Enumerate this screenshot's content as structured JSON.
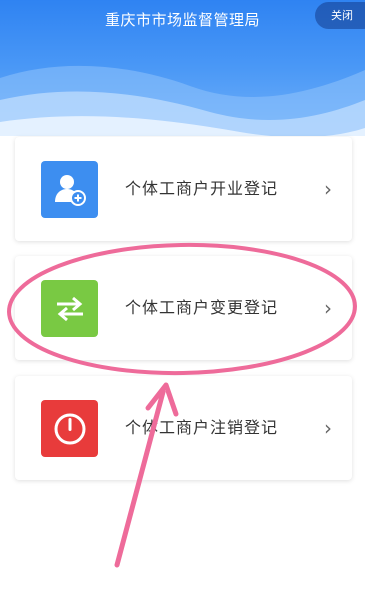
{
  "header": {
    "title": "重庆市市场监督管理局",
    "close_label": "关闭"
  },
  "items": [
    {
      "label": "个体工商户开业登记",
      "icon": "add-user-icon",
      "color": "#3d8ef0"
    },
    {
      "label": "个体工商户变更登记",
      "icon": "swap-arrows-icon",
      "color": "#79c943"
    },
    {
      "label": "个体工商户注销登记",
      "icon": "power-icon",
      "color": "#e83b3b"
    }
  ],
  "chevron": "›",
  "annotation": {
    "color": "#ee6b9a"
  }
}
